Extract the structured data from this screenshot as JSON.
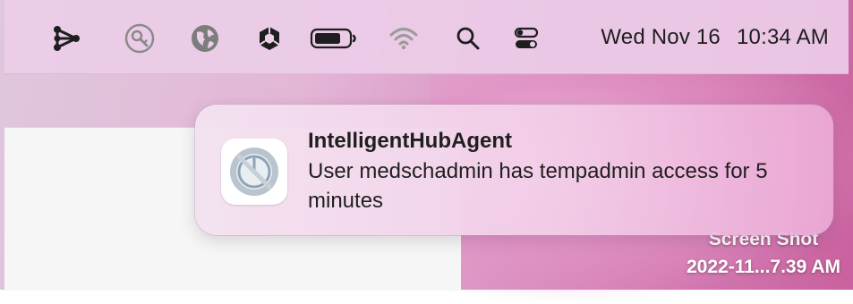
{
  "menubar": {
    "icons": [
      "workspace-one-icon",
      "key-icon",
      "globe-icon",
      "hub-agent-icon",
      "battery-icon",
      "wifi-icon",
      "search-icon",
      "control-center-icon"
    ],
    "date": "Wed Nov 16",
    "time": "10:34 AM"
  },
  "notification": {
    "app_name": "IntelligentHubAgent",
    "message": "User medschadmin has tempadmin access for 5 minutes"
  },
  "desktop_file": {
    "name_line1": "Screen Shot",
    "name_line2": "2022-11...7.39 AM"
  },
  "colors": {
    "menubar_bg": "#eccde8",
    "text": "#1e1e1e",
    "desktop_accent": "#c9619f"
  }
}
